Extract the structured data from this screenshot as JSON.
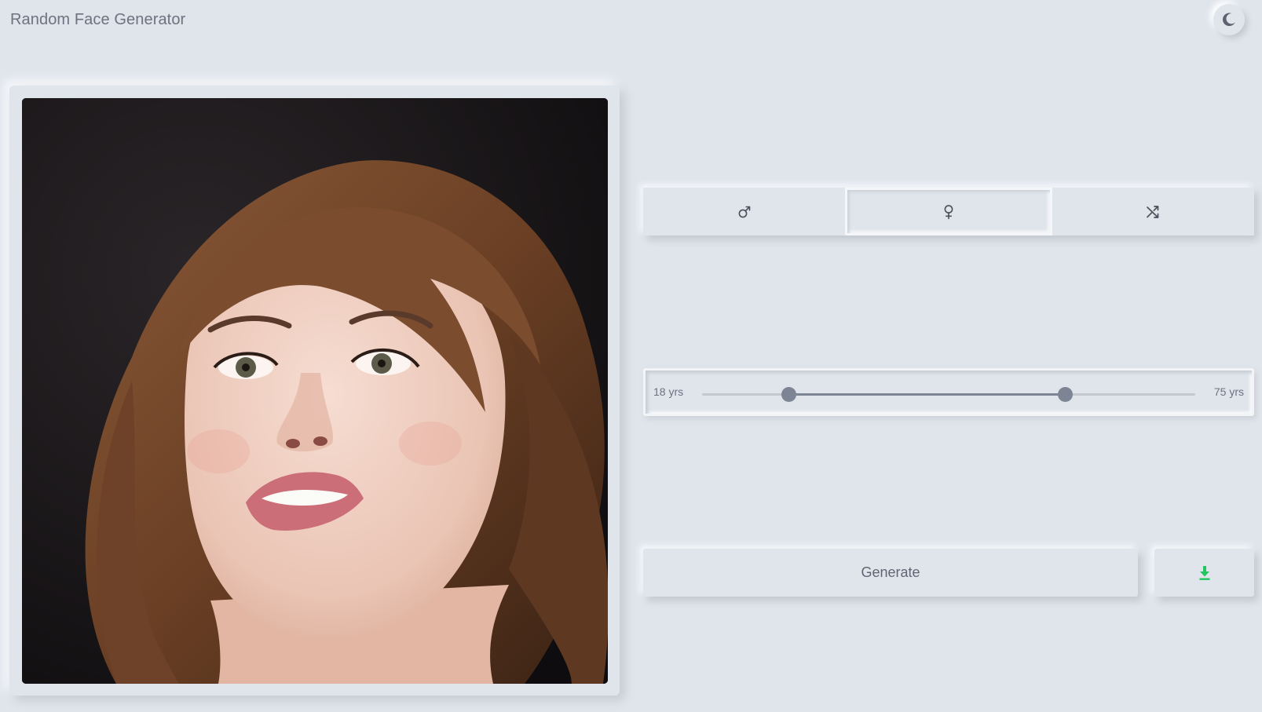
{
  "app": {
    "title": "Random Face Generator"
  },
  "header": {
    "theme_toggle_icon": "moon-icon"
  },
  "face": {
    "alt": "Generated face"
  },
  "gender_options": [
    {
      "icon": "male-icon",
      "selected": false
    },
    {
      "icon": "female-icon",
      "selected": true
    },
    {
      "icon": "shuffle-icon",
      "selected": false
    }
  ],
  "age": {
    "min_label": "18 yrs",
    "max_label": "75 yrs",
    "range_min": 18,
    "range_max": 75,
    "low_value": 28,
    "high_value": 60
  },
  "actions": {
    "generate_label": "Generate",
    "download_icon": "download-icon"
  },
  "colors": {
    "background": "#e0e5ec",
    "accent": "#7d8594",
    "download": "#22c55e"
  }
}
